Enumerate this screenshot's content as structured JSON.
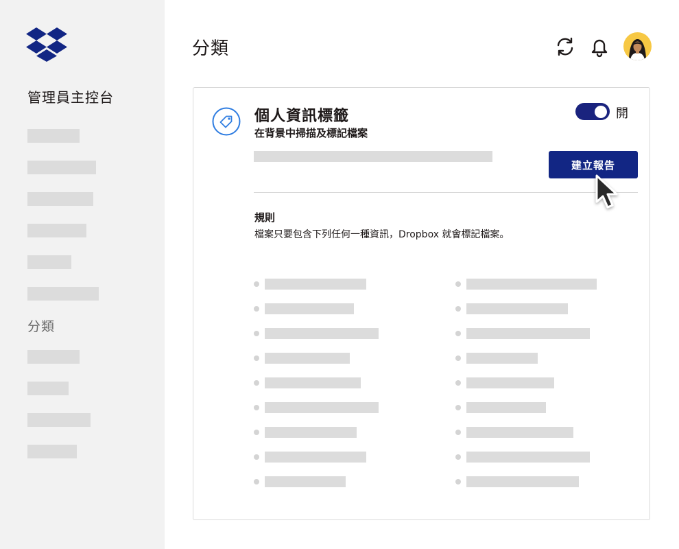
{
  "sidebar": {
    "title": "管理員主控台",
    "section_label": "分類",
    "logo": "dropbox-logo",
    "placeholder_items_group1": 6,
    "placeholder_items_group2": 4
  },
  "header": {
    "title": "分類",
    "icons": [
      "sync-icon",
      "bell-icon",
      "avatar"
    ]
  },
  "card": {
    "icon": "tag-icon",
    "title": "個人資訊標籤",
    "subtitle": "在背景中掃描及標記檔案",
    "toggle": {
      "state": "on",
      "label": "開"
    },
    "report_button_label": "建立報告",
    "rules": {
      "heading": "規則",
      "description": "檔案只要包含下列任何一種資訊，Dropbox 就會標記檔案。",
      "placeholder_rows_per_column": 9
    }
  },
  "colors": {
    "accent": "#122684",
    "toggle_on": "#1a237e",
    "tag_icon": "#2f7de1",
    "sidebar_bg": "#f2f2f2",
    "placeholder": "#dcdcdc",
    "avatar_bg": "#f7c844"
  }
}
